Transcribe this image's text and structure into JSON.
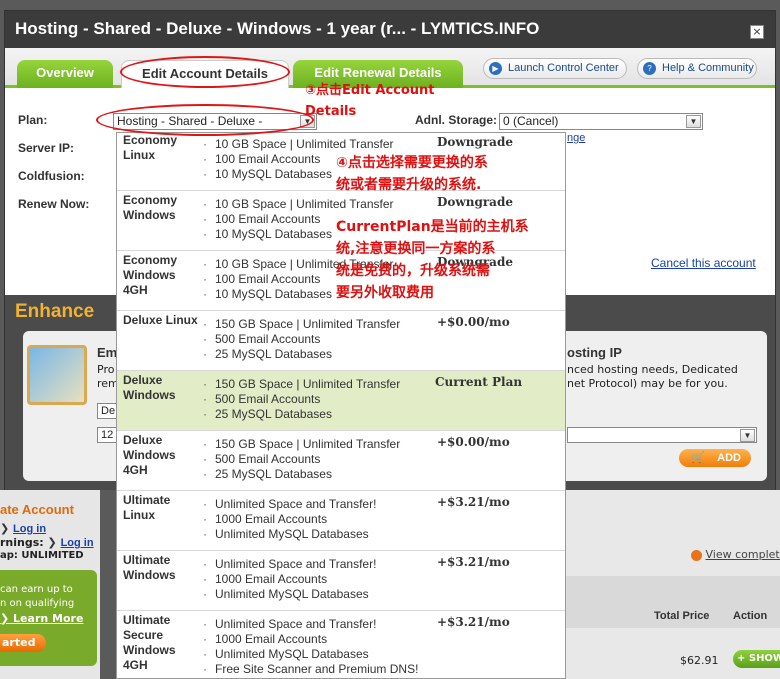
{
  "window": {
    "title": "Hosting - Shared - Deluxe - Windows - 1 year (r... - LYMTICS.INFO",
    "close_glyph": "×"
  },
  "tabs": [
    {
      "label": "Overview"
    },
    {
      "label": "Edit Account Details"
    },
    {
      "label": "Edit Renewal Details"
    }
  ],
  "header_links": {
    "launch": "Launch Control Center",
    "help": "Help & Community"
  },
  "form": {
    "plan_label": "Plan:",
    "plan_value": "Hosting - Shared - Deluxe -",
    "server_ip_label": "Server IP:",
    "coldfusion_label": "Coldfusion:",
    "renew_now_label": "Renew Now:",
    "storage_label": "Adnl. Storage:",
    "storage_value": "0 (Cancel)",
    "partial_link": "nge",
    "cancel_account": "Cancel this account"
  },
  "enhance": {
    "title": "Enhance",
    "heading_left": "Em",
    "text_left_1": "Pro",
    "text_left_2": "rem",
    "select1": "De",
    "select2": "12",
    "heading_right": "osting IP",
    "text_right_1": "nced hosting needs, Dedicated",
    "text_right_2": "net Protocol) may be for you.",
    "add_label": "ADD"
  },
  "background_page": {
    "left_title": "ate Account",
    "left_login": "Log in",
    "left_earnings": "rnings:",
    "left_login2": "Log in",
    "left_unlimited": "ap: UNLIMITED",
    "promo_1": "can earn up to",
    "promo_2": "n on qualifying",
    "learn_more": "Learn More",
    "started": "arted",
    "view_complete": "View complete",
    "col_total": "Total Price",
    "col_action": "Action",
    "price": "$62.91",
    "show_label": "+ SHOW"
  },
  "plans": [
    {
      "name": "Economy Linux",
      "features": [
        "10 GB Space | Unlimited Transfer",
        "100 Email Accounts",
        "10 MySQL Databases"
      ],
      "price": "Downgrade",
      "current": false
    },
    {
      "name": "Economy Windows",
      "features": [
        "10 GB Space | Unlimited Transfer",
        "100 Email Accounts",
        "10 MySQL Databases"
      ],
      "price": "Downgrade",
      "current": false
    },
    {
      "name": "Economy Windows 4GH",
      "features": [
        "10 GB Space | Unlimited Transfer",
        "100 Email Accounts",
        "10 MySQL Databases"
      ],
      "price": "Downgrade",
      "current": false
    },
    {
      "name": "Deluxe Linux",
      "features": [
        "150 GB Space | Unlimited Transfer",
        "500 Email Accounts",
        "25 MySQL Databases"
      ],
      "price": "+$0.00/mo",
      "current": false
    },
    {
      "name": "Deluxe Windows",
      "features": [
        "150 GB Space | Unlimited Transfer",
        "500 Email Accounts",
        "25 MySQL Databases"
      ],
      "price": "Current Plan",
      "current": true
    },
    {
      "name": "Deluxe Windows 4GH",
      "features": [
        "150 GB Space | Unlimited Transfer",
        "500 Email Accounts",
        "25 MySQL Databases"
      ],
      "price": "+$0.00/mo",
      "current": false
    },
    {
      "name": "Ultimate Linux",
      "features": [
        "Unlimited Space and Transfer!",
        "1000 Email Accounts",
        "Unlimited MySQL Databases"
      ],
      "price": "+$3.21/mo",
      "current": false
    },
    {
      "name": "Ultimate Windows",
      "features": [
        "Unlimited Space and Transfer!",
        "1000 Email Accounts",
        "Unlimited MySQL Databases"
      ],
      "price": "+$3.21/mo",
      "current": false
    },
    {
      "name": "Ultimate Secure Windows 4GH",
      "features": [
        "Unlimited Space and Transfer!",
        "1000 Email Accounts",
        "Unlimited MySQL Databases",
        "Free Site Scanner and Premium DNS!"
      ],
      "price": "+$3.21/mo",
      "current": false
    }
  ],
  "annotations": {
    "step3_line1": "③点击Edit Account",
    "step3_line2": "Details",
    "step4_line1": "④点击选择需要更换的系",
    "step4_line2": "统或者需要升级的系统.",
    "note_line1": "CurrentPlan是当前的主机系",
    "note_line2": "统,注意更换同一方案的系",
    "note_line3": "统是免费的，升级系统需",
    "note_line4": "要另外收取费用"
  },
  "colors": {
    "tab_green": "#7cbf2a",
    "annotation_red": "#e01010",
    "current_plan_bg": "#e2edc8",
    "enhance_title": "#f2b230"
  }
}
